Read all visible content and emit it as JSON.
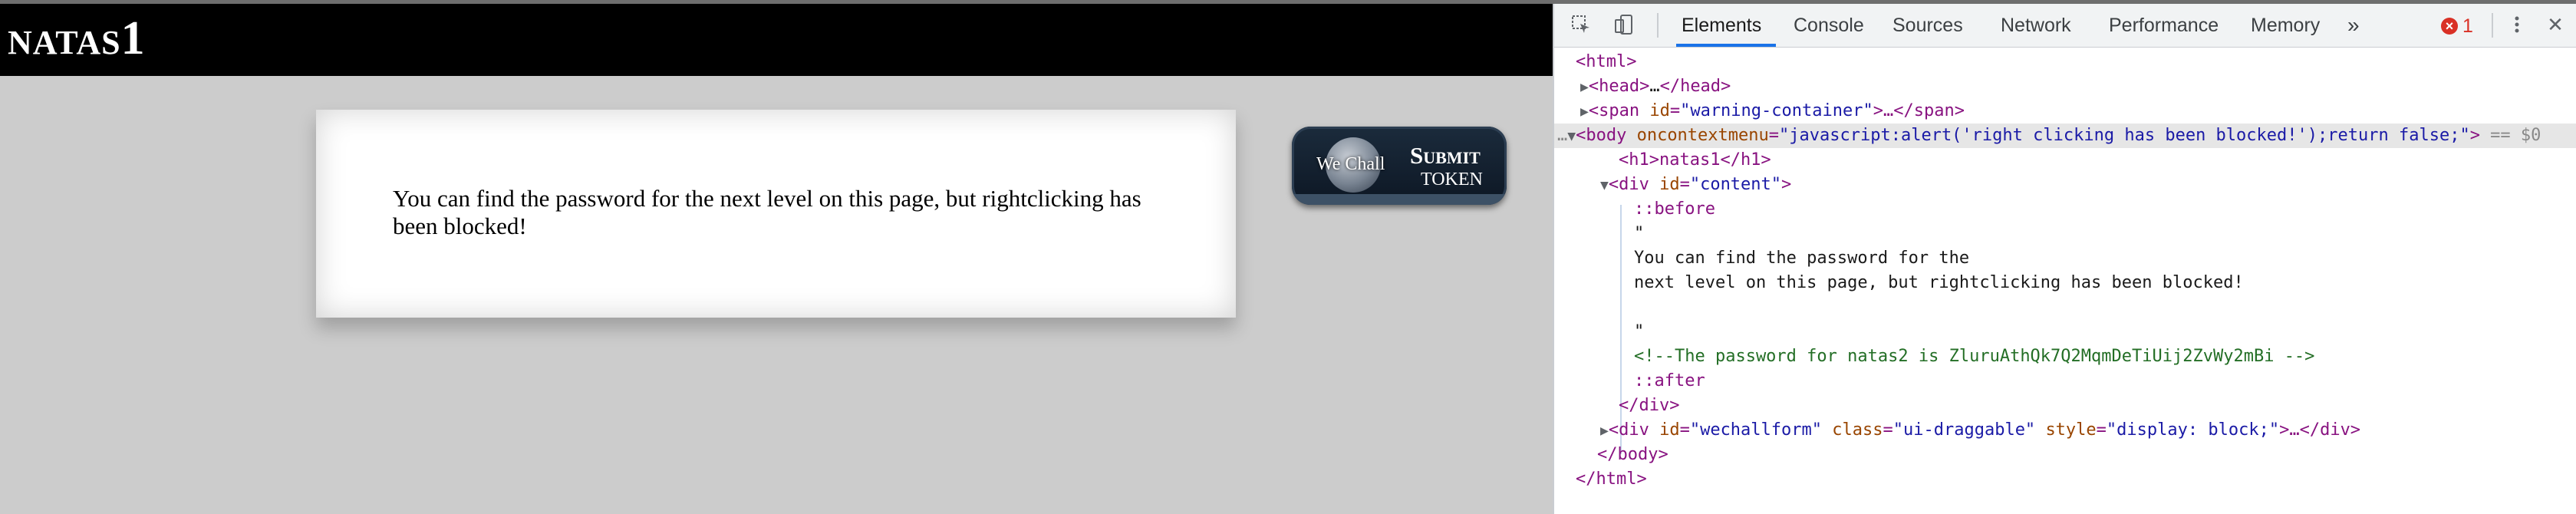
{
  "page": {
    "title_small": "NATAS",
    "title_big": "1",
    "content_text": "You can find the password for the next level on this page, but rightclicking has been blocked!",
    "wechall": {
      "logo_text": "We Chall",
      "submit": "Submit",
      "token": "TOKEN"
    }
  },
  "devtools": {
    "tabs": [
      "Elements",
      "Console",
      "Sources",
      "Network",
      "Performance",
      "Memory"
    ],
    "more_tabs": "»",
    "error_count": "1",
    "close": "✕",
    "dom": {
      "l1": "<html>",
      "l2_tag": "<head>",
      "l2_dots": "…",
      "l2_end": "</head>",
      "l3_open": "<span ",
      "l3_attr": "id",
      "l3_val": "\"warning-container\"",
      "l3_rest": ">…</span>",
      "l4_prefix": "…",
      "l4_open": "<body ",
      "l4_attr": "oncontextmenu",
      "l4_val": "\"javascript:alert('right clicking has been blocked!');return false;\"",
      "l4_close": ">",
      "l4_suffix": " == $0",
      "l5": "<h1>natas1</h1>",
      "l6_open": "<div ",
      "l6_attr": "id",
      "l6_val": "\"content\"",
      "l6_close": ">",
      "l7": "::before",
      "l8": "\"",
      "l9": "You can find the password for the",
      "l10": "next level on this page, but rightclicking has been blocked!",
      "l11": "\"",
      "l12": "<!--The password for natas2 is ZluruAthQk7Q2MqmDeTiUij2ZvWy2mBi -->",
      "l13": "::after",
      "l14": "</div>",
      "l15_open": "<div ",
      "l15_a1": "id",
      "l15_v1": "\"wechallform\"",
      "l15_a2": "class",
      "l15_v2": "\"ui-draggable\"",
      "l15_a3": "style",
      "l15_v3": "\"display: block;\"",
      "l15_rest": ">…</div>",
      "l16": "</body>",
      "l17": "</html>"
    }
  }
}
